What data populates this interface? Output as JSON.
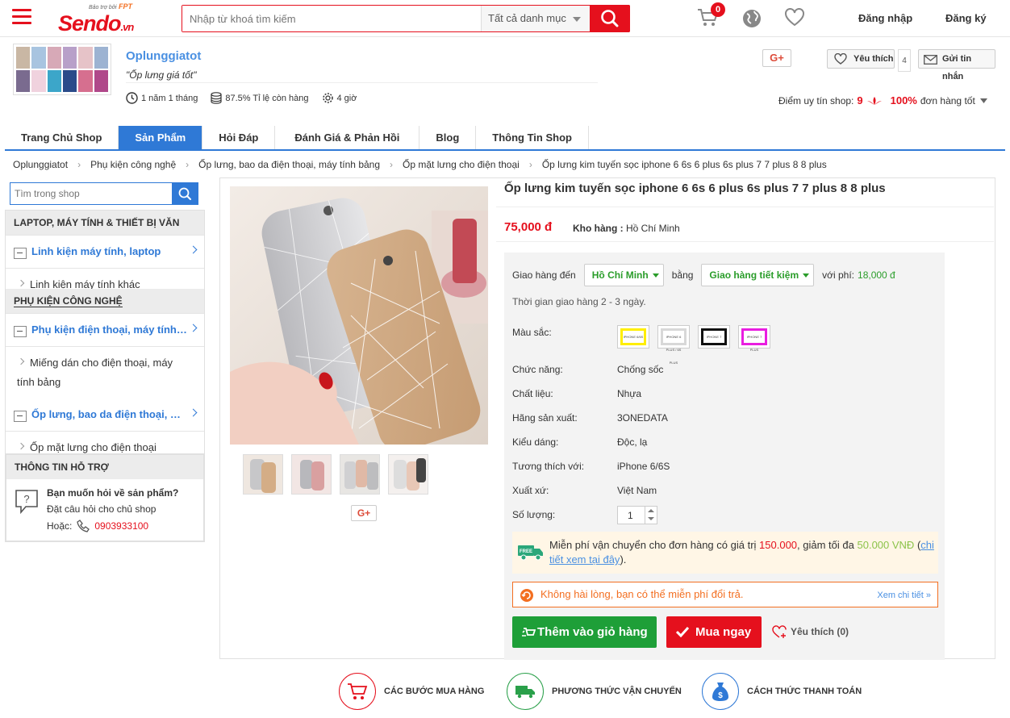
{
  "header": {
    "logo_small": "Bảo trợ bởi",
    "logo_fpt": "FPT",
    "logo_main": "Sendo",
    "logo_suffix": ".vn",
    "search_placeholder": "Nhập từ khoá tìm kiếm",
    "category": "Tất cả danh mục",
    "cart_count": "0",
    "login": "Đăng nhập",
    "register": "Đăng ký"
  },
  "shop": {
    "name": "Oplunggiatot",
    "slogan": "\"Ốp lưng giá tốt\"",
    "stats": {
      "age": "1 năm 1 tháng",
      "stock_rate": "87.5% Tỉ lệ còn hàng",
      "response": "4 giờ"
    },
    "gplus": "G+",
    "like_label": "Yêu thích",
    "like_count": "4",
    "message_label": "Gửi tin nhắn",
    "reputation_label": "Điểm uy tín shop:",
    "reputation_score": "9",
    "good_orders_pct": "100%",
    "good_orders_label": "đơn hàng tốt"
  },
  "tabs": [
    "Trang Chủ Shop",
    "Sản Phẩm",
    "Hỏi Đáp",
    "Đánh Giá & Phản Hồi",
    "Blog",
    "Thông Tin Shop"
  ],
  "active_tab": "Sản Phẩm",
  "breadcrumb": [
    "Oplunggiatot",
    "Phụ kiện công nghệ",
    "Ốp lưng, bao da điện thoại, máy tính bảng",
    "Ốp mặt lưng cho điện thoại",
    "Ốp lưng kim tuyến sọc iphone 6 6s 6 plus 6s plus 7 7 plus 8 8 plus"
  ],
  "sidebar": {
    "search_placeholder": "Tìm trong shop",
    "group1_title": "Laptop, máy tính & thiết bị văn",
    "group1_items": [
      "Linh kiện máy tính, laptop",
      "Linh kiện máy tính khác"
    ],
    "group2_title": "Phụ kiện công nghệ",
    "group2_items": [
      "Phụ kiện điện thoại, máy tính bảng",
      "Miếng dán cho điện thoại, máy tính bảng",
      "Ốp lưng, bao da điện thoại, máy tính bảng",
      "Ốp mặt lưng cho điện thoại"
    ],
    "support_title": "Thông tin hỗ trợ",
    "support_q": "Bạn muốn hỏi về sản phẩm?",
    "support_d": "Đặt câu hỏi cho chủ shop",
    "support_or": "Hoặc:",
    "support_phone": "0903933100"
  },
  "product": {
    "title": "Ốp lưng kim tuyến sọc iphone 6 6s 6 plus 6s plus 7 7 plus 8 8 plus",
    "price": "75,000 đ",
    "warehouse_label": "Kho hàng :",
    "warehouse": "Hồ Chí Minh",
    "ship_to_label": "Giao hàng đến",
    "ship_to": "Hồ Chí Minh",
    "ship_by_label": "bằng",
    "ship_method": "Giao hàng tiết kiệm",
    "fee_label": "với phí:",
    "fee": "18,000 đ",
    "ship_time": "Thời gian giao hàng 2 - 3 ngày.",
    "color_label": "Màu sắc:",
    "swatches": [
      {
        "label": "IPHONE 6/6S",
        "color": "#ffee00"
      },
      {
        "label": "IPHONE 6 PLUS / 6S PLUS",
        "color": "#d8d8d8"
      },
      {
        "label": "IPHONE 7",
        "color": "#111111"
      },
      {
        "label": "IPHONE 7 PLUS",
        "color": "#e91ee0"
      }
    ],
    "attributes": [
      {
        "label": "Chức năng:",
        "value": "Chống sốc"
      },
      {
        "label": "Chất liệu:",
        "value": "Nhựa"
      },
      {
        "label": "Hãng sản xuất:",
        "value": "3ONEDATA"
      },
      {
        "label": "Kiểu dáng:",
        "value": "Độc, lạ"
      },
      {
        "label": "Tương thích với:",
        "value": "iPhone 6/6S"
      },
      {
        "label": "Xuất xứ:",
        "value": "Việt Nam"
      }
    ],
    "qty_label": "Số lượng:",
    "qty": "1",
    "free_pre": "Miễn phí vận chuyển cho đơn hàng có giá trị",
    "free_min": "150.000",
    "free_mid": ", giảm tối đa",
    "free_max": "50.000 VNĐ",
    "free_open": " (",
    "free_link": "chi tiết xem tại đây",
    "free_close": ").",
    "return_text": "Không hài lòng, bạn có thể miễn phí đổi trả.",
    "return_more": "Xem chi tiết »",
    "add_to_cart": "Thêm vào giỏ hàng",
    "buy_now": "Mua ngay",
    "like": "Yêu thích (0)",
    "gplus": "G+"
  },
  "footer": [
    "CÁC BƯỚC MUA HÀNG",
    "PHƯƠNG THỨC VẬN CHUYỂN",
    "CÁCH THỨC THANH TOÁN"
  ],
  "colors": {
    "brand_red": "#e5101d",
    "tab_blue": "#2f79d6",
    "green": "#1e9f38"
  }
}
